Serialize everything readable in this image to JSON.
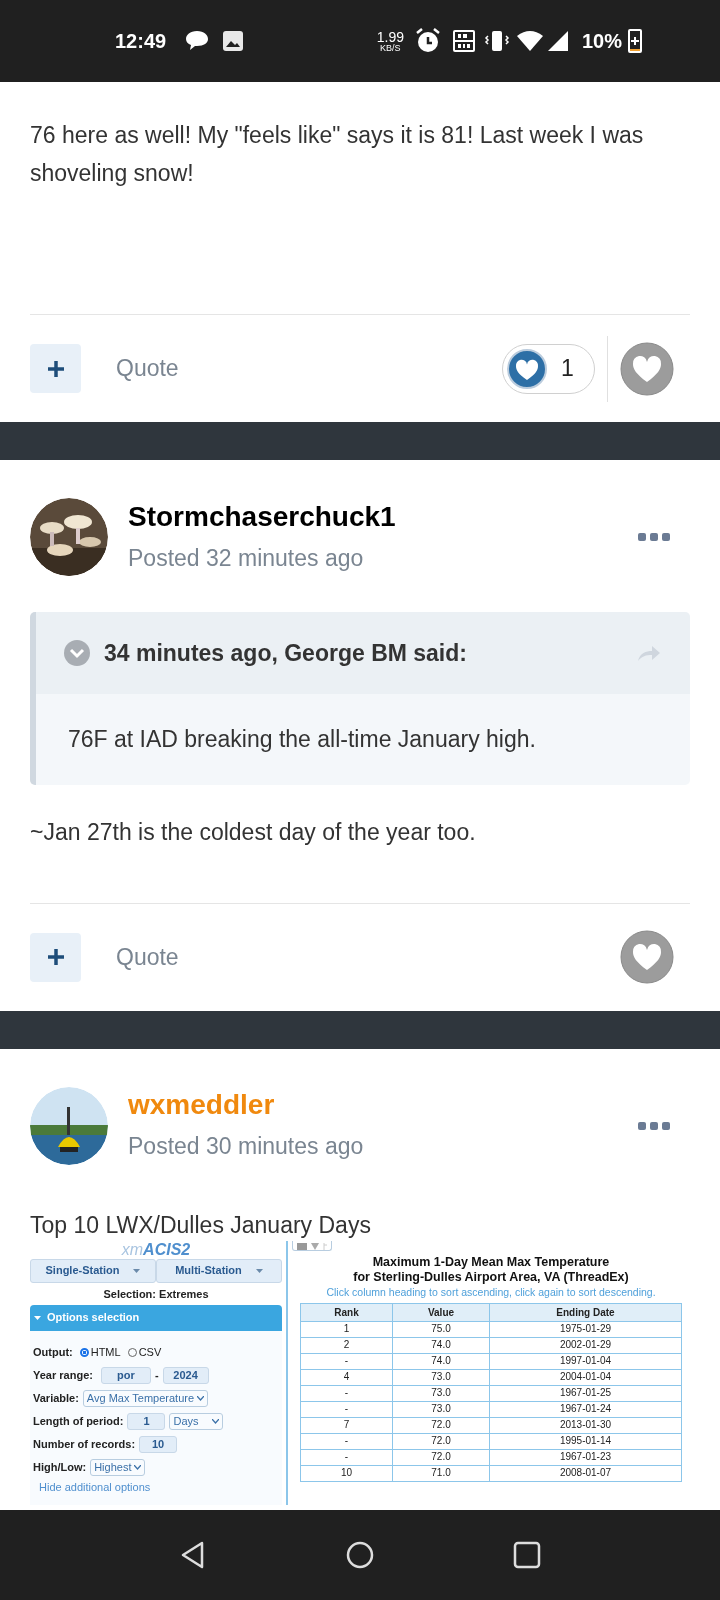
{
  "status_bar": {
    "time": "12:49",
    "net_speed": "1.99",
    "net_unit": "KB/S",
    "battery": "10%"
  },
  "posts": [
    {
      "body": "76 here as well! My \"feels like\" says it is 81! Last week I was shoveling snow!",
      "actions": {
        "quote": "Quote",
        "reaction_count": "1"
      }
    },
    {
      "author": "Stormchaserchuck1",
      "color": "#000000",
      "posted": "Posted 32 minutes ago",
      "quote": {
        "header": "34 minutes ago, George BM said:",
        "text": "76F at IAD breaking the all-time January high."
      },
      "body": "~Jan 27th is the coldest day of the year too.",
      "actions": {
        "quote": "Quote"
      }
    },
    {
      "author": "wxmeddler",
      "color": "#f0890e",
      "posted": "Posted 30 minutes ago",
      "body": "Top 10 LWX/Dulles January Days",
      "attachment": {
        "logo_prefix": "xm",
        "logo_main": "ACIS2",
        "menus": [
          "Single-Station",
          "Multi-Station"
        ],
        "selection": "Selection: Extremes",
        "options_header": "Options selection",
        "output": {
          "label": "Output:",
          "options": [
            {
              "label": "HTML",
              "selected": true
            },
            {
              "label": "CSV",
              "selected": false
            }
          ]
        },
        "year_range": {
          "label": "Year range:",
          "from": "por",
          "separator": "-",
          "to": "2024"
        },
        "variable": {
          "label": "Variable:",
          "value": "Avg Max Temperature"
        },
        "period": {
          "label": "Length of period:",
          "value": "1",
          "unit": "Days"
        },
        "records": {
          "label": "Number of records:",
          "value": "10"
        },
        "high_low": {
          "label": "High/Low:",
          "value": "Highest"
        },
        "link": "Hide additional options",
        "title": "Maximum 1-Day Mean Max Temperature",
        "subtitle": "for Sterling-Dulles Airport Area, VA (ThreadEx)",
        "hint": "Click column heading to sort ascending, click again to sort descending.",
        "columns": [
          "Rank",
          "Value",
          "Ending Date"
        ],
        "rows": [
          [
            "1",
            "75.0",
            "1975-01-29"
          ],
          [
            "2",
            "74.0",
            "2002-01-29"
          ],
          [
            "-",
            "74.0",
            "1997-01-04"
          ],
          [
            "4",
            "73.0",
            "2004-01-04"
          ],
          [
            "-",
            "73.0",
            "1967-01-25"
          ],
          [
            "-",
            "73.0",
            "1967-01-24"
          ],
          [
            "7",
            "72.0",
            "2013-01-30"
          ],
          [
            "-",
            "72.0",
            "1995-01-14"
          ],
          [
            "-",
            "72.0",
            "1967-01-23"
          ],
          [
            "10",
            "71.0",
            "2008-01-07"
          ]
        ]
      }
    }
  ]
}
